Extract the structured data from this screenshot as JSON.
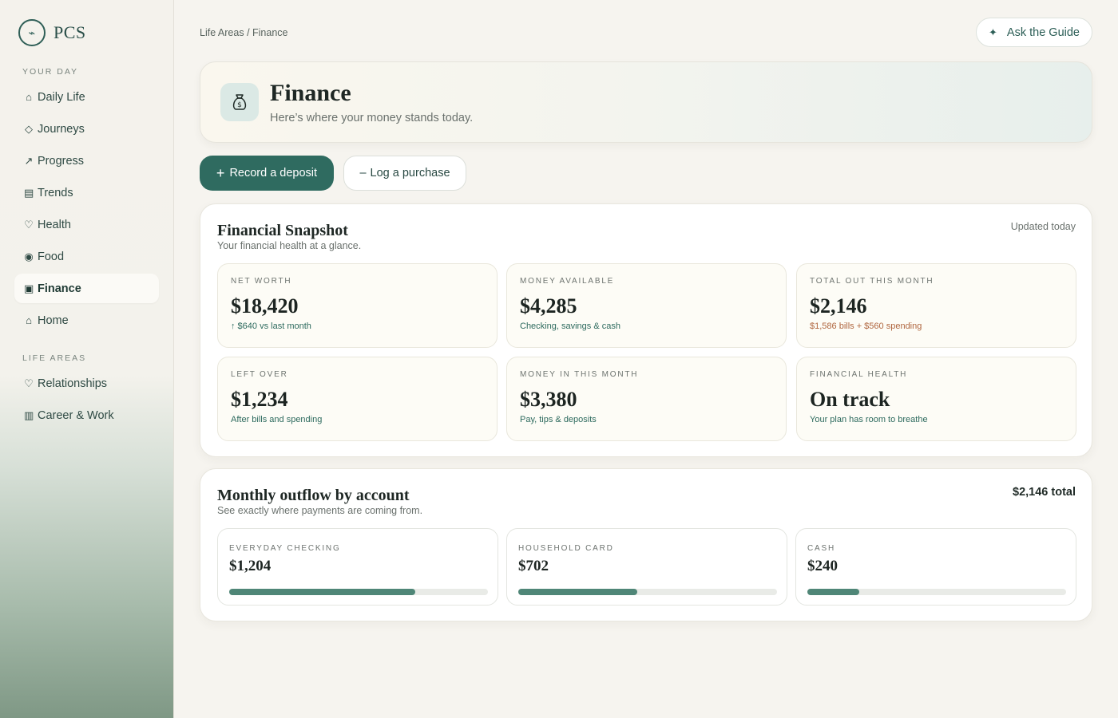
{
  "brand": {
    "mark": "⌁",
    "name": "PCS"
  },
  "sidebar": {
    "sections": [
      {
        "label": "YOUR DAY"
      },
      {
        "label": "LIFE AREAS"
      }
    ],
    "items": [
      {
        "icon": "⌂",
        "icon_name": "home-icon",
        "label": "Daily Life"
      },
      {
        "icon": "◇",
        "icon_name": "diamond-icon",
        "label": "Journeys"
      },
      {
        "icon": "↗",
        "icon_name": "arrow-up-right-icon",
        "label": "Progress"
      },
      {
        "icon": "▤",
        "icon_name": "chart-lines-icon",
        "label": "Trends"
      },
      {
        "icon": "♡",
        "icon_name": "heart-icon",
        "label": "Health"
      },
      {
        "icon": "◉",
        "icon_name": "circle-dot-icon",
        "label": "Food"
      },
      {
        "icon": "▣",
        "icon_name": "square-icon",
        "label": "Finance",
        "active": true
      },
      {
        "icon": "⌂",
        "icon_name": "home-icon",
        "label": "Home"
      },
      {
        "icon": "♡",
        "icon_name": "heart-icon",
        "label": "Relationships"
      },
      {
        "icon": "▥",
        "icon_name": "briefcase-icon",
        "label": "Career & Work"
      }
    ]
  },
  "header": {
    "breadcrumb": "Life Areas / Finance",
    "guide_icon": "✦",
    "guide_label": "Ask the Guide"
  },
  "hero": {
    "title": "Finance",
    "subtitle": "Here’s where your money stands today."
  },
  "actions": {
    "deposit_icon": "+",
    "deposit_label": "Record a deposit",
    "purchase_icon": "–",
    "purchase_label": "Log a purchase"
  },
  "snapshot": {
    "title": "Financial Snapshot",
    "subtitle": "Your financial health at a glance.",
    "updated": "Updated today",
    "cards": [
      {
        "label": "NET WORTH",
        "value": "$18,420",
        "note": "↑ $640 vs last month",
        "tone": "green"
      },
      {
        "label": "MONEY AVAILABLE",
        "value": "$4,285",
        "note": "Checking, savings & cash",
        "tone": "green"
      },
      {
        "label": "TOTAL OUT THIS MONTH",
        "value": "$2,146",
        "note": "$1,586 bills + $560 spending",
        "tone": "warm"
      },
      {
        "label": "LEFT OVER",
        "value": "$1,234",
        "note": "After bills and spending",
        "tone": "green"
      },
      {
        "label": "MONEY IN THIS MONTH",
        "value": "$3,380",
        "note": "Pay, tips & deposits",
        "tone": "green"
      },
      {
        "label": "FINANCIAL HEALTH",
        "value": "On track",
        "note": "Your plan has room to breathe",
        "tone": "green"
      }
    ]
  },
  "outflow": {
    "title": "Monthly outflow by account",
    "subtitle": "See exactly where payments are coming from.",
    "total": "$2,146 total",
    "accounts": [
      {
        "label": "EVERYDAY CHECKING",
        "value": "$1,204",
        "share": 0.72
      },
      {
        "label": "HOUSEHOLD CARD",
        "value": "$702",
        "share": 0.46
      },
      {
        "label": "CASH",
        "value": "$240",
        "share": 0.2
      }
    ]
  },
  "colors": {
    "accent": "#2f6b60",
    "bar": "#4f8677",
    "warm_note": "#b0663f"
  }
}
